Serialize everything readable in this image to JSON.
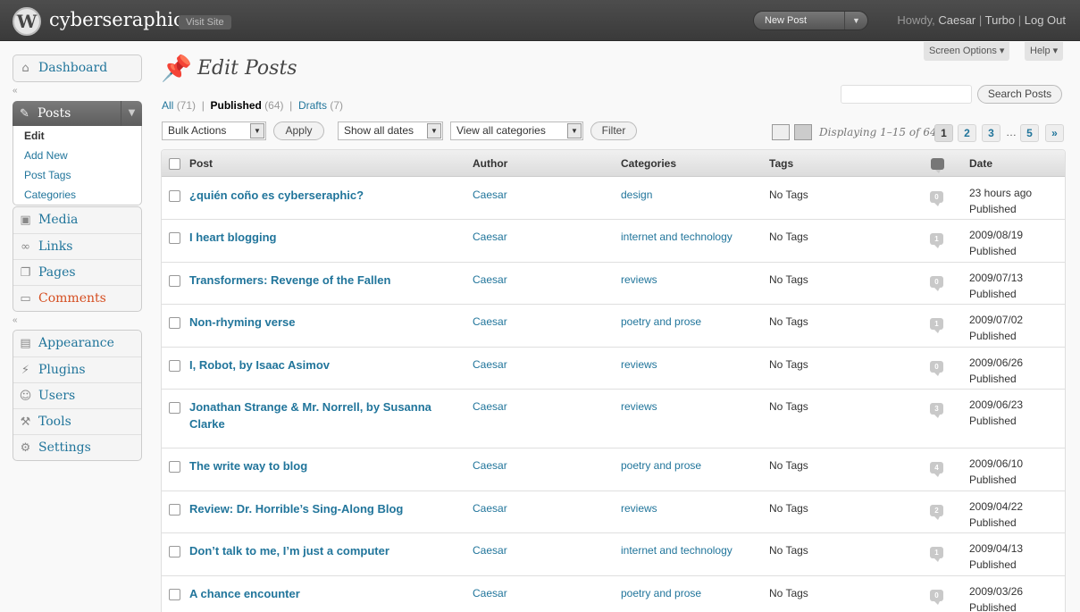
{
  "header": {
    "site_title": "cyberseraphic",
    "visit_site": "Visit Site",
    "new_post": "New Post",
    "howdy": "Howdy,",
    "user": "Caesar",
    "turbo": "Turbo",
    "logout": "Log Out"
  },
  "screen_options": "Screen Options ▾",
  "help": "Help ▾",
  "sidebar": {
    "dashboard": "Dashboard",
    "posts": "Posts",
    "posts_sub": [
      "Edit",
      "Add New",
      "Post Tags",
      "Categories"
    ],
    "group2": [
      "Media",
      "Links",
      "Pages",
      "Comments"
    ],
    "group3": [
      "Appearance",
      "Plugins",
      "Users",
      "Tools",
      "Settings"
    ]
  },
  "main": {
    "title": "Edit Posts",
    "filters": {
      "all": "All",
      "all_count": "(71)",
      "published": "Published",
      "published_count": "(64)",
      "drafts": "Drafts",
      "drafts_count": "(7)"
    },
    "search_button": "Search Posts",
    "search_value": "",
    "bulk_actions": "Bulk Actions",
    "apply": "Apply",
    "dates": "Show all dates",
    "categories": "View all categories",
    "filter": "Filter",
    "displaying": "Displaying 1–15 of 64",
    "pages": [
      "1",
      "2",
      "3",
      "5",
      "»"
    ],
    "dots": "…"
  },
  "table": {
    "columns": [
      "Post",
      "Author",
      "Categories",
      "Tags",
      "Date"
    ],
    "rows": [
      {
        "title": "¿quién coño es cyberseraphic?",
        "author": "Caesar",
        "category": "design",
        "tags": "No Tags",
        "comments": "0",
        "date": "23 hours ago",
        "status": "Published"
      },
      {
        "title": "I heart blogging",
        "author": "Caesar",
        "category": "internet and technology",
        "tags": "No Tags",
        "comments": "1",
        "date": "2009/08/19",
        "status": "Published"
      },
      {
        "title": "Transformers: Revenge of the Fallen",
        "author": "Caesar",
        "category": "reviews",
        "tags": "No Tags",
        "comments": "0",
        "date": "2009/07/13",
        "status": "Published"
      },
      {
        "title": "Non-rhyming verse",
        "author": "Caesar",
        "category": "poetry and prose",
        "tags": "No Tags",
        "comments": "1",
        "date": "2009/07/02",
        "status": "Published"
      },
      {
        "title": "I, Robot, by Isaac Asimov",
        "author": "Caesar",
        "category": "reviews",
        "tags": "No Tags",
        "comments": "0",
        "date": "2009/06/26",
        "status": "Published"
      },
      {
        "title": "Jonathan Strange & Mr. Norrell, by Susanna Clarke",
        "author": "Caesar",
        "category": "reviews",
        "tags": "No Tags",
        "comments": "3",
        "date": "2009/06/23",
        "status": "Published"
      },
      {
        "title": "The write way to blog",
        "author": "Caesar",
        "category": "poetry and prose",
        "tags": "No Tags",
        "comments": "4",
        "date": "2009/06/10",
        "status": "Published"
      },
      {
        "title": "Review: Dr. Horrible’s Sing-Along Blog",
        "author": "Caesar",
        "category": "reviews",
        "tags": "No Tags",
        "comments": "2",
        "date": "2009/04/22",
        "status": "Published"
      },
      {
        "title": "Don’t talk to me, I’m just a computer",
        "author": "Caesar",
        "category": "internet and technology",
        "tags": "No Tags",
        "comments": "1",
        "date": "2009/04/13",
        "status": "Published"
      },
      {
        "title": "A chance encounter",
        "author": "Caesar",
        "category": "poetry and prose",
        "tags": "No Tags",
        "comments": "0",
        "date": "2009/03/26",
        "status": "Published"
      }
    ]
  }
}
